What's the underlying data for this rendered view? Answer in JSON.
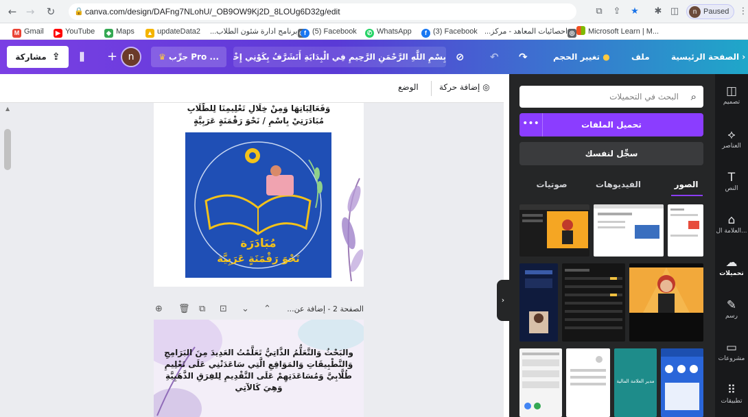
{
  "browser": {
    "url": "canva.com/design/DAFng7NLohU/_OB9OW9Kj2D_8LOUg6D32g/edit",
    "profile_initial": "n",
    "profile_status": "Paused"
  },
  "bookmarks": [
    {
      "label": "Gmail",
      "color": "#ea4335"
    },
    {
      "label": "YouTube",
      "color": "#ff0000"
    },
    {
      "label": "Maps",
      "color": "#34a853"
    },
    {
      "label": "updateData2",
      "color": "#f4b400"
    },
    {
      "label": "برنامج ادارة شئون الطلاب...",
      "color": "#5f6368"
    },
    {
      "label": "(5) Facebook",
      "color": "#1877f2"
    },
    {
      "label": "WhatsApp",
      "color": "#25d366"
    },
    {
      "label": "(3) Facebook",
      "color": "#1877f2"
    },
    {
      "label": "احصائيات المعاهد - مركز...",
      "color": "#5f6368"
    },
    {
      "label": "Microsoft Learn | M...",
      "color": "#f25022"
    }
  ],
  "topbar": {
    "home": "الصفحة الرئيسية",
    "file": "ملف",
    "resize": "تغيير الحجم",
    "title": "بِسْمِ اللَّهِ الرَّحْمَنِ الرَّحِيمِ فِي الْبِدَايَةِ أَتَشَرَّفُ بِكَوْنِي إِخْذِي...",
    "try_pro": "جرِّب Pro ...",
    "avatar": "n",
    "plus": "+",
    "share": "مشاركة"
  },
  "canvas_toolbar": {
    "animate": "إضافة حركة",
    "position": "الوضع"
  },
  "page1": {
    "text_line1": "وَفَعَالِيَاتِهَا وَمِنْ خِلَالِ تَعْلِيمِنَا لِلطُّلَابِ",
    "text_line2": "مُبَادَرَتِيْ بِاسْمِ / نَحْوَ رَقْمَنَةٍ عَرَبِيَّةٍ",
    "logo_text1": "مُبَادَرَة",
    "logo_text2": "نَحْوَ رَقْمَنَةٍ عَرَبِيَّة"
  },
  "page_header": {
    "label": "الصفحة 2 - إضافة عن..."
  },
  "page2": {
    "line1": "والبَحْثُ وَالتَّعَلُّمُ الذَّاتِيُّ تَعَلَّمْتُ العَدِيدَ مِنَ البَرَامِجِ",
    "line2": "وَالتَّطْبِيقَاتِ وَالمَوَاقِعِ الَّتِي سَاعَدَتْنِي عَلَى تَعْلِيمِ",
    "line3": "طُلَّابِيَّ وَمُسَاعَدَتِهِمْ عَلَى التَّقْدِيمِ لِلفِرَقِ الذَّهَبِيَّةِ",
    "line4": "وَهِيَ كَالآتِي"
  },
  "sidepanel": {
    "search_placeholder": "البحث في التحميلات",
    "upload": "تحميل الملفات",
    "more": "•••",
    "record": "سجِّل لنفسك",
    "tabs": [
      "الصور",
      "الفيديوهات",
      "صوتيات"
    ],
    "thumb_caption": "مدير العلامة المالية"
  },
  "rail": [
    {
      "label": "تصميم",
      "icon": "design-icon"
    },
    {
      "label": "العناصر",
      "icon": "elements-icon"
    },
    {
      "label": "النص",
      "icon": "text-icon"
    },
    {
      "label": "العلامة ال...",
      "icon": "brand-icon"
    },
    {
      "label": "تحميلات",
      "icon": "upload-cloud-icon"
    },
    {
      "label": "رسم",
      "icon": "draw-icon"
    },
    {
      "label": "مشروعات",
      "icon": "folder-icon"
    },
    {
      "label": "تطبيقات",
      "icon": "apps-icon"
    }
  ],
  "colors": {
    "accent": "#8b3dff",
    "panel": "#252627",
    "rail": "#18191b"
  }
}
